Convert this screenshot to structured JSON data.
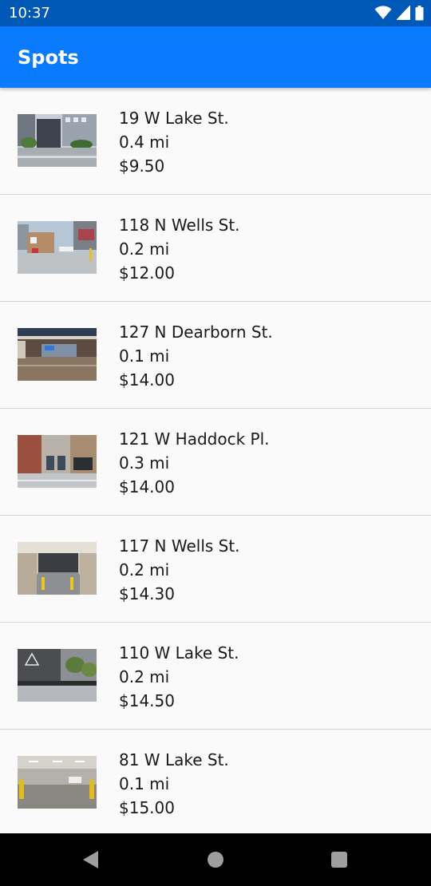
{
  "status_bar": {
    "time": "10:37",
    "icons": [
      "wifi-icon",
      "signal-icon",
      "battery-icon"
    ]
  },
  "app_bar": {
    "title": "Spots",
    "color": "#0a7bff"
  },
  "spots": [
    {
      "address": "19 W Lake St.",
      "distance": "0.4 mi",
      "price": "$9.50",
      "thumbnail": "street-photo-icon"
    },
    {
      "address": "118 N Wells St.",
      "distance": "0.2 mi",
      "price": "$12.00",
      "thumbnail": "parking-lot-photo-icon"
    },
    {
      "address": "127 N Dearborn St.",
      "distance": "0.1 mi",
      "price": "$14.00",
      "thumbnail": "garage-entrance-photo-icon"
    },
    {
      "address": "121 W Haddock Pl.",
      "distance": "0.3 mi",
      "price": "$14.00",
      "thumbnail": "street-photo-icon"
    },
    {
      "address": "117 N Wells St.",
      "distance": "0.2 mi",
      "price": "$14.30",
      "thumbnail": "garage-ramp-photo-icon"
    },
    {
      "address": "110 W Lake St.",
      "distance": "0.2 mi",
      "price": "$14.50",
      "thumbnail": "street-photo-icon"
    },
    {
      "address": "81 W Lake St.",
      "distance": "0.1 mi",
      "price": "$15.00",
      "thumbnail": "garage-interior-photo-icon"
    }
  ],
  "nav_bar": {
    "icons": [
      "back-icon",
      "home-icon",
      "recents-icon"
    ]
  }
}
